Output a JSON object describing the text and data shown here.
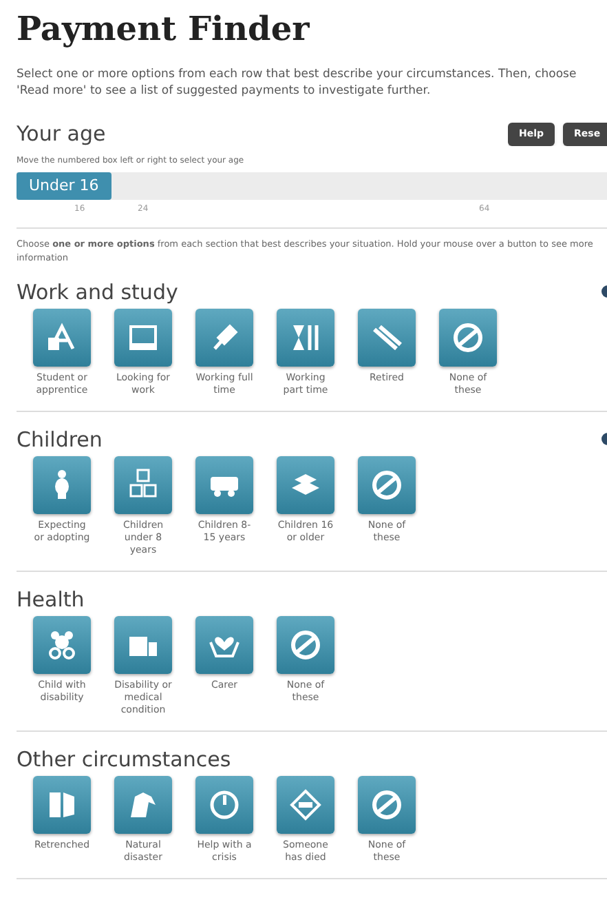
{
  "title": "Payment Finder",
  "intro": "Select one or more options from each row that best describe your circumstances. Then, choose 'Read more' to see a list of suggested payments to investigate further.",
  "age": {
    "heading": "Your age",
    "buttons": [
      "Help",
      "Rese"
    ],
    "hint": "Move the numbered box left or right to select your age",
    "slider": {
      "handle_label": "Under 16",
      "level": 0,
      "ticks": [
        "16",
        "24",
        "64"
      ]
    }
  },
  "instructions": "Choose **one or more options** from each section that best describes your situation. Hold your mouse over a button to see more information",
  "sections": [
    {
      "heading": "Work and study",
      "help": true,
      "options": [
        "Student or apprentice",
        "Looking for work",
        "Working full time",
        "Working part time",
        "Retired",
        "None of these"
      ]
    },
    {
      "heading": "Children",
      "help": true,
      "options": [
        "Expecting or adopting",
        "Children under 8 years",
        "Children 8-15 years",
        "Children 16 or older",
        "None of these"
      ]
    },
    {
      "heading": "Health",
      "help": false,
      "options": [
        "Child with disability",
        "Disability or medical condition",
        "Carer",
        "None of these"
      ]
    },
    {
      "heading": "Other circumstances",
      "help": false,
      "options": [
        "Retrenched",
        "Natural disaster",
        "Help with a crisis",
        "Someone has died",
        "None of these"
      ]
    }
  ]
}
